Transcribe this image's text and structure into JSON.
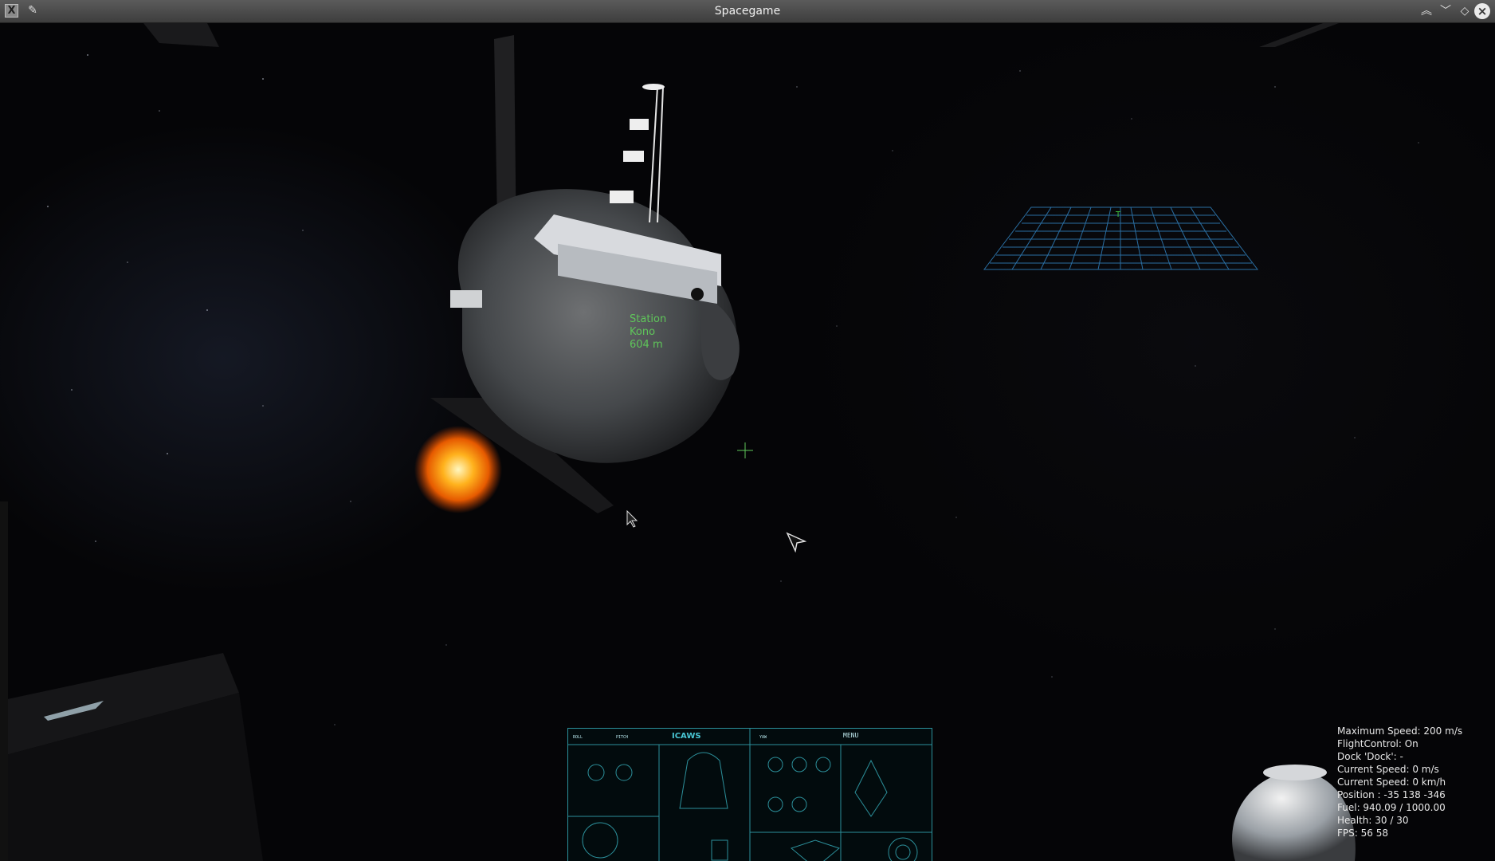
{
  "window": {
    "title": "Spacegame",
    "app_icon": "x-icon",
    "pin_icon": "pin-icon",
    "controls": [
      "keep-above-icon",
      "minimize-icon",
      "maximize-icon",
      "close-icon"
    ]
  },
  "target": {
    "line1": "Station",
    "line2": "Kono",
    "line3": "604 m",
    "color": "#5fc65a"
  },
  "stats": [
    {
      "label": "Maximum Speed: 200 m/s"
    },
    {
      "label": "FlightControl: On"
    },
    {
      "label": "Dock 'Dock': -"
    },
    {
      "label": "Current Speed: 0 m/s"
    },
    {
      "label": "Current Speed: 0 km/h"
    },
    {
      "label": "Position    : -35 138 -346"
    },
    {
      "label": "Fuel: 940.09 / 1000.00"
    },
    {
      "label": "Health: 30 / 30"
    },
    {
      "label": "FPS: 56 58"
    }
  ],
  "cockpit": {
    "brand": "ICAWS",
    "menu": "MENU",
    "accent": "#2c8f9a"
  }
}
